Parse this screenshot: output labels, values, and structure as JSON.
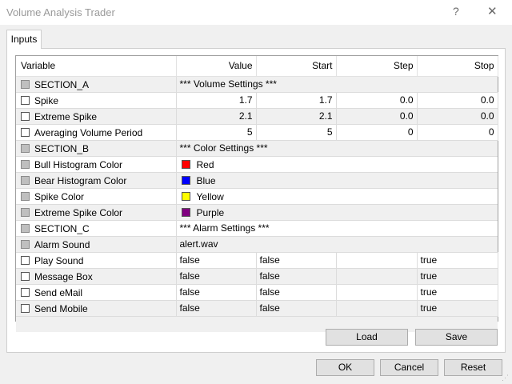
{
  "window": {
    "title": "Volume Analysis Trader",
    "help_glyph": "?",
    "close_glyph": "✕"
  },
  "tabs": [
    {
      "label": "Inputs"
    }
  ],
  "grid": {
    "columns": [
      "Variable",
      "Value",
      "Start",
      "Step",
      "Stop"
    ],
    "rows": [
      {
        "name": "SECTION_A",
        "value": "*** Volume Settings ***",
        "start": "",
        "step": "",
        "stop": ""
      },
      {
        "name": "Spike",
        "value": "1.7",
        "start": "1.7",
        "step": "0.0",
        "stop": "0.0"
      },
      {
        "name": "Extreme Spike",
        "value": "2.1",
        "start": "2.1",
        "step": "0.0",
        "stop": "0.0"
      },
      {
        "name": "Averaging Volume Period",
        "value": "5",
        "start": "5",
        "step": "0",
        "stop": "0"
      },
      {
        "name": "SECTION_B",
        "value": "*** Color Settings ***",
        "start": "",
        "step": "",
        "stop": ""
      },
      {
        "name": "Bull Histogram Color",
        "value": "Red",
        "swatch": "#ff0000"
      },
      {
        "name": "Bear Histogram Color",
        "value": "Blue",
        "swatch": "#0000ff"
      },
      {
        "name": "Spike Color",
        "value": "Yellow",
        "swatch": "#ffff00"
      },
      {
        "name": "Extreme Spike Color",
        "value": "Purple",
        "swatch": "#800080"
      },
      {
        "name": "SECTION_C",
        "value": "*** Alarm Settings ***",
        "start": "",
        "step": "",
        "stop": ""
      },
      {
        "name": "Alarm Sound",
        "value": "alert.wav",
        "start": "",
        "step": "",
        "stop": ""
      },
      {
        "name": "Play Sound",
        "value": "false",
        "start": "false",
        "step": "",
        "stop": "true"
      },
      {
        "name": "Message Box",
        "value": "false",
        "start": "false",
        "step": "",
        "stop": "true"
      },
      {
        "name": "Send eMail",
        "value": "false",
        "start": "false",
        "step": "",
        "stop": "true"
      },
      {
        "name": "Send Mobile",
        "value": "false",
        "start": "false",
        "step": "",
        "stop": "true"
      }
    ]
  },
  "buttons": {
    "load": "Load",
    "save": "Save",
    "ok": "OK",
    "cancel": "Cancel",
    "reset": "Reset"
  },
  "grip_glyph": "⋰"
}
